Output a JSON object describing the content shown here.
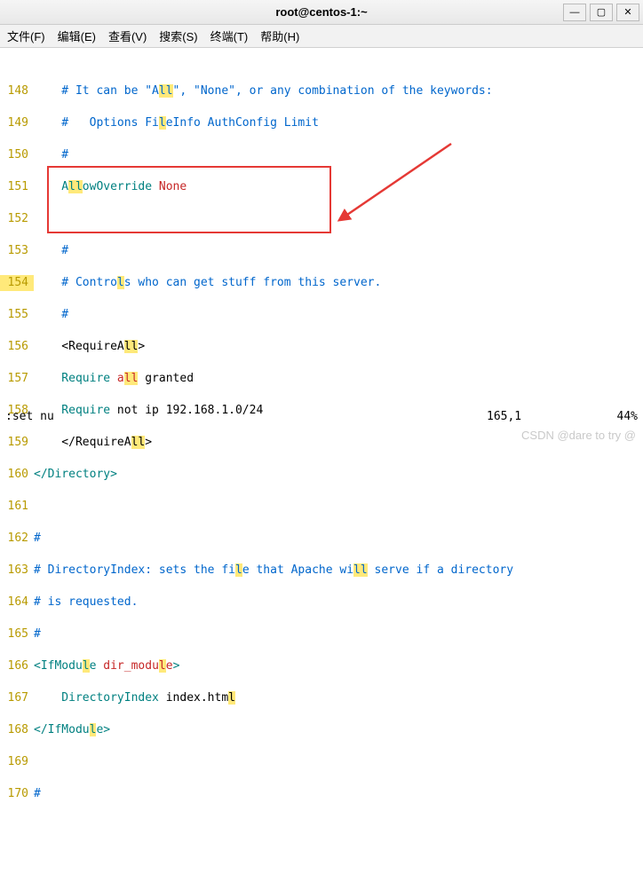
{
  "window": {
    "title": "root@centos-1:~",
    "min_icon": "—",
    "max_icon": "▢",
    "close_icon": "✕"
  },
  "menu": {
    "file": "文件(F)",
    "edit": "编辑(E)",
    "view": "查看(V)",
    "search": "搜索(S)",
    "terminal": "终端(T)",
    "help": "帮助(H)"
  },
  "lines": {
    "n148": "148",
    "n149": "149",
    "n150": "150",
    "n151": "151",
    "n152": "152",
    "n153": "153",
    "n154": "154",
    "n155": "155",
    "n156": "156",
    "n157": "157",
    "n158": "158",
    "n159": "159",
    "n160": "160",
    "n161": "161",
    "n162": "162",
    "n163": "163",
    "n164": "164",
    "n165": "165",
    "n166": "166",
    "n167": "167",
    "n168": "168",
    "n169": "169",
    "n170": "170"
  },
  "code": {
    "l148_a": "    # It can be \"A",
    "l148_b": "\", \"None\", or any combination of the keywords:",
    "l149_a": "    #   Options Fi",
    "l149_b": "eInfo AuthConfig Limit",
    "l150": "    #",
    "l151_a": "    A",
    "l151_b": "owOverride ",
    "l151_c": "None",
    "l152": "",
    "l153": "    #",
    "l154_a": "    # Contro",
    "l154_b": "s who can get stuff from this server.",
    "l155": "    #",
    "l156_a": "    <RequireA",
    "l156_b": ">",
    "l157_a": "    Require",
    "l157_b": " a",
    "l157_c": " granted",
    "l158_a": "    Require",
    "l158_b": " not ip 192.168.1.0/24",
    "l159_a": "    </RequireA",
    "l159_b": ">",
    "l160_a": "</",
    "l160_b": "Directory",
    "l160_c": ">",
    "l161": "",
    "l162": "#",
    "l163_a": "# DirectoryIndex: sets the fi",
    "l163_b": "e that Apache wi",
    "l163_c": " serve if a directory",
    "l164": "# is requested.",
    "l165": "#",
    "l166_a": "<",
    "l166_b": "IfModu",
    "l166_c": "e",
    "l166_d": " dir_modu",
    "l166_e": "e",
    "l166_f": ">",
    "l167_a": "    DirectoryIndex",
    "l167_b": " index.htm",
    "l168_a": "</",
    "l168_b": "IfModu",
    "l168_c": "e",
    "l168_d": ">",
    "l169": "",
    "l170": "#",
    "hl_ll": "ll",
    "hl_l": "l"
  },
  "status": {
    "cmd": ":set nu",
    "pos": "165,1",
    "pct": "44%"
  },
  "watermark": "CSDN @dare to try @"
}
